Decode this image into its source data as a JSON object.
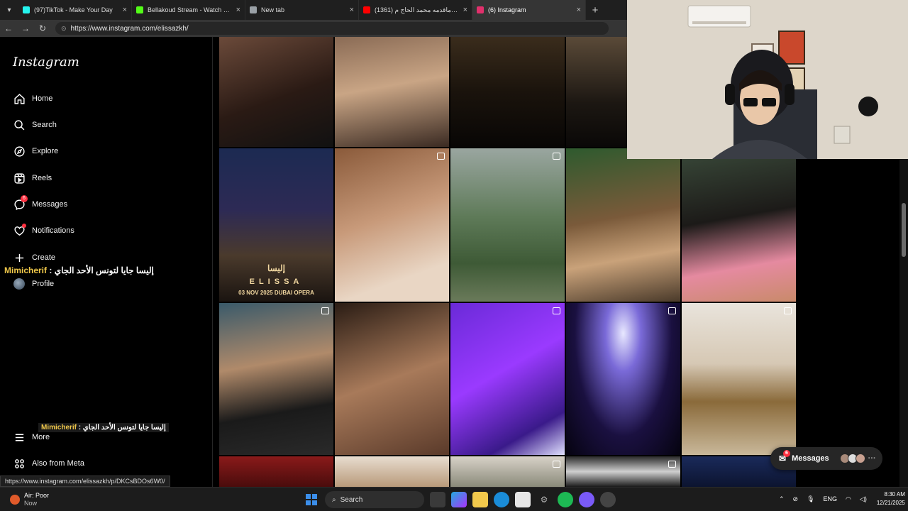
{
  "browser": {
    "tabs": [
      {
        "title": "(97)TikTok - Make Your Day",
        "color": "#25f4ee",
        "active": false
      },
      {
        "title": "Bellakoud Stream - Watch Live on",
        "color": "#53fc18",
        "active": false
      },
      {
        "title": "New tab",
        "color": "#9aa0a6",
        "active": false
      },
      {
        "title": "(1361) أفضل ماقدمه محمد الحاج م...",
        "color": "#ff0000",
        "active": false
      },
      {
        "title": "(6) Instagram",
        "color": "#e1306c",
        "active": true
      }
    ],
    "url": "https://www.instagram.com/elissazkh/",
    "status_url": "https://www.instagram.com/elissazkh/p/DKCsBDOs6W0/"
  },
  "sidebar": {
    "logo": "Instagram",
    "items": [
      {
        "label": "Home",
        "icon": "home-icon"
      },
      {
        "label": "Search",
        "icon": "search-icon"
      },
      {
        "label": "Explore",
        "icon": "explore-icon"
      },
      {
        "label": "Reels",
        "icon": "reels-icon"
      },
      {
        "label": "Messages",
        "icon": "messenger-icon",
        "badge": "6"
      },
      {
        "label": "Notifications",
        "icon": "heart-icon",
        "dot": true
      },
      {
        "label": "Create",
        "icon": "plus-icon"
      },
      {
        "label": "Profile",
        "icon": "avatar"
      },
      {
        "label": "More",
        "icon": "menu-icon"
      },
      {
        "label": "Also from Meta",
        "icon": "meta-icon"
      }
    ]
  },
  "chat_overlay": {
    "user": "Mimicherif",
    "separator": " : ",
    "message": "إليسا جايا لتونس الأحد الجاي"
  },
  "poster": {
    "title": "ELISSA",
    "date": "03 NOV 2025 DUBAI OPERA",
    "arabic": "إليسا"
  },
  "messages_pill": {
    "label": "Messages",
    "badge": "6"
  },
  "taskbar": {
    "weather_title": "Air: Poor",
    "weather_sub": "Now",
    "search_label": "Search",
    "lang": "ENG",
    "time": "8:30 AM",
    "date": "12/21/2025"
  }
}
